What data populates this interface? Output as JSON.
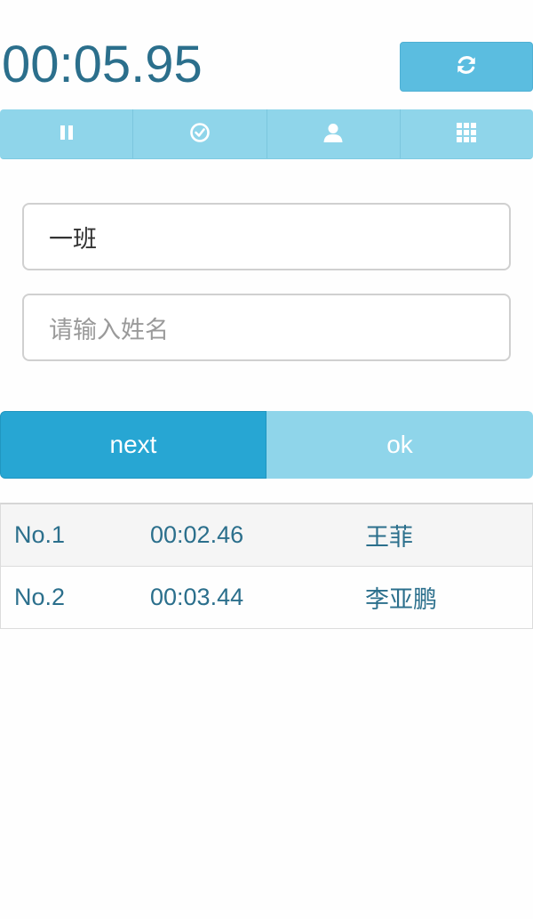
{
  "timer": {
    "display": "00:05.95"
  },
  "toolbar": {
    "reset_icon": "refresh-icon",
    "items": [
      {
        "icon": "pause-icon"
      },
      {
        "icon": "check-circle-icon"
      },
      {
        "icon": "user-icon"
      },
      {
        "icon": "grid-icon"
      }
    ]
  },
  "form": {
    "class_value": "一班",
    "name_placeholder": "请输入姓名"
  },
  "buttons": {
    "next_label": "next",
    "ok_label": "ok"
  },
  "records": [
    {
      "no": "No.1",
      "time": "00:02.46",
      "name": "王菲"
    },
    {
      "no": "No.2",
      "time": "00:03.44",
      "name": "李亚鹏"
    }
  ],
  "colors": {
    "primary": "#27a6d3",
    "light": "#8fd5ea",
    "text": "#2b6f8c"
  }
}
